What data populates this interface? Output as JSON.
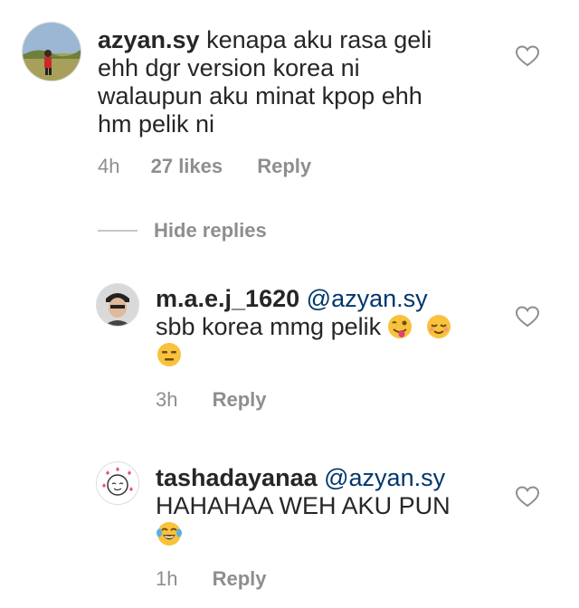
{
  "comments": [
    {
      "username": "azyan.sy",
      "mention": "",
      "text_lines": [
        "kenapa aku rasa geli",
        "ehh dgr version korea ni",
        "walaupun aku minat kpop ehh",
        "hm pelik ni"
      ],
      "time": "4h",
      "likes": "27 likes",
      "reply_label": "Reply"
    },
    {
      "username": "m.a.e.j_1620",
      "mention": "@azyan.sy",
      "text_lines": [
        "sbb korea mmg pelik"
      ],
      "time": "3h",
      "likes": "",
      "reply_label": "Reply"
    },
    {
      "username": "tashadayanaa",
      "mention": "@azyan.sy",
      "text_lines": [
        "HAHAHAA WEH AKU PUN"
      ],
      "time": "1h",
      "likes": "",
      "reply_label": "Reply"
    }
  ],
  "hide_replies": "Hide replies",
  "icons": {
    "heart": "heart-outline-icon",
    "emoji_wink_tongue": "winking-face-with-tongue-emoji",
    "emoji_relieved": "relieved-face-emoji",
    "emoji_expressionless": "expressionless-face-emoji",
    "emoji_tears_of_joy": "face-with-tears-of-joy-emoji"
  },
  "colors": {
    "text": "#262626",
    "muted": "#8e8e8e",
    "mention": "#00376b",
    "emoji": "#f9c23c"
  }
}
